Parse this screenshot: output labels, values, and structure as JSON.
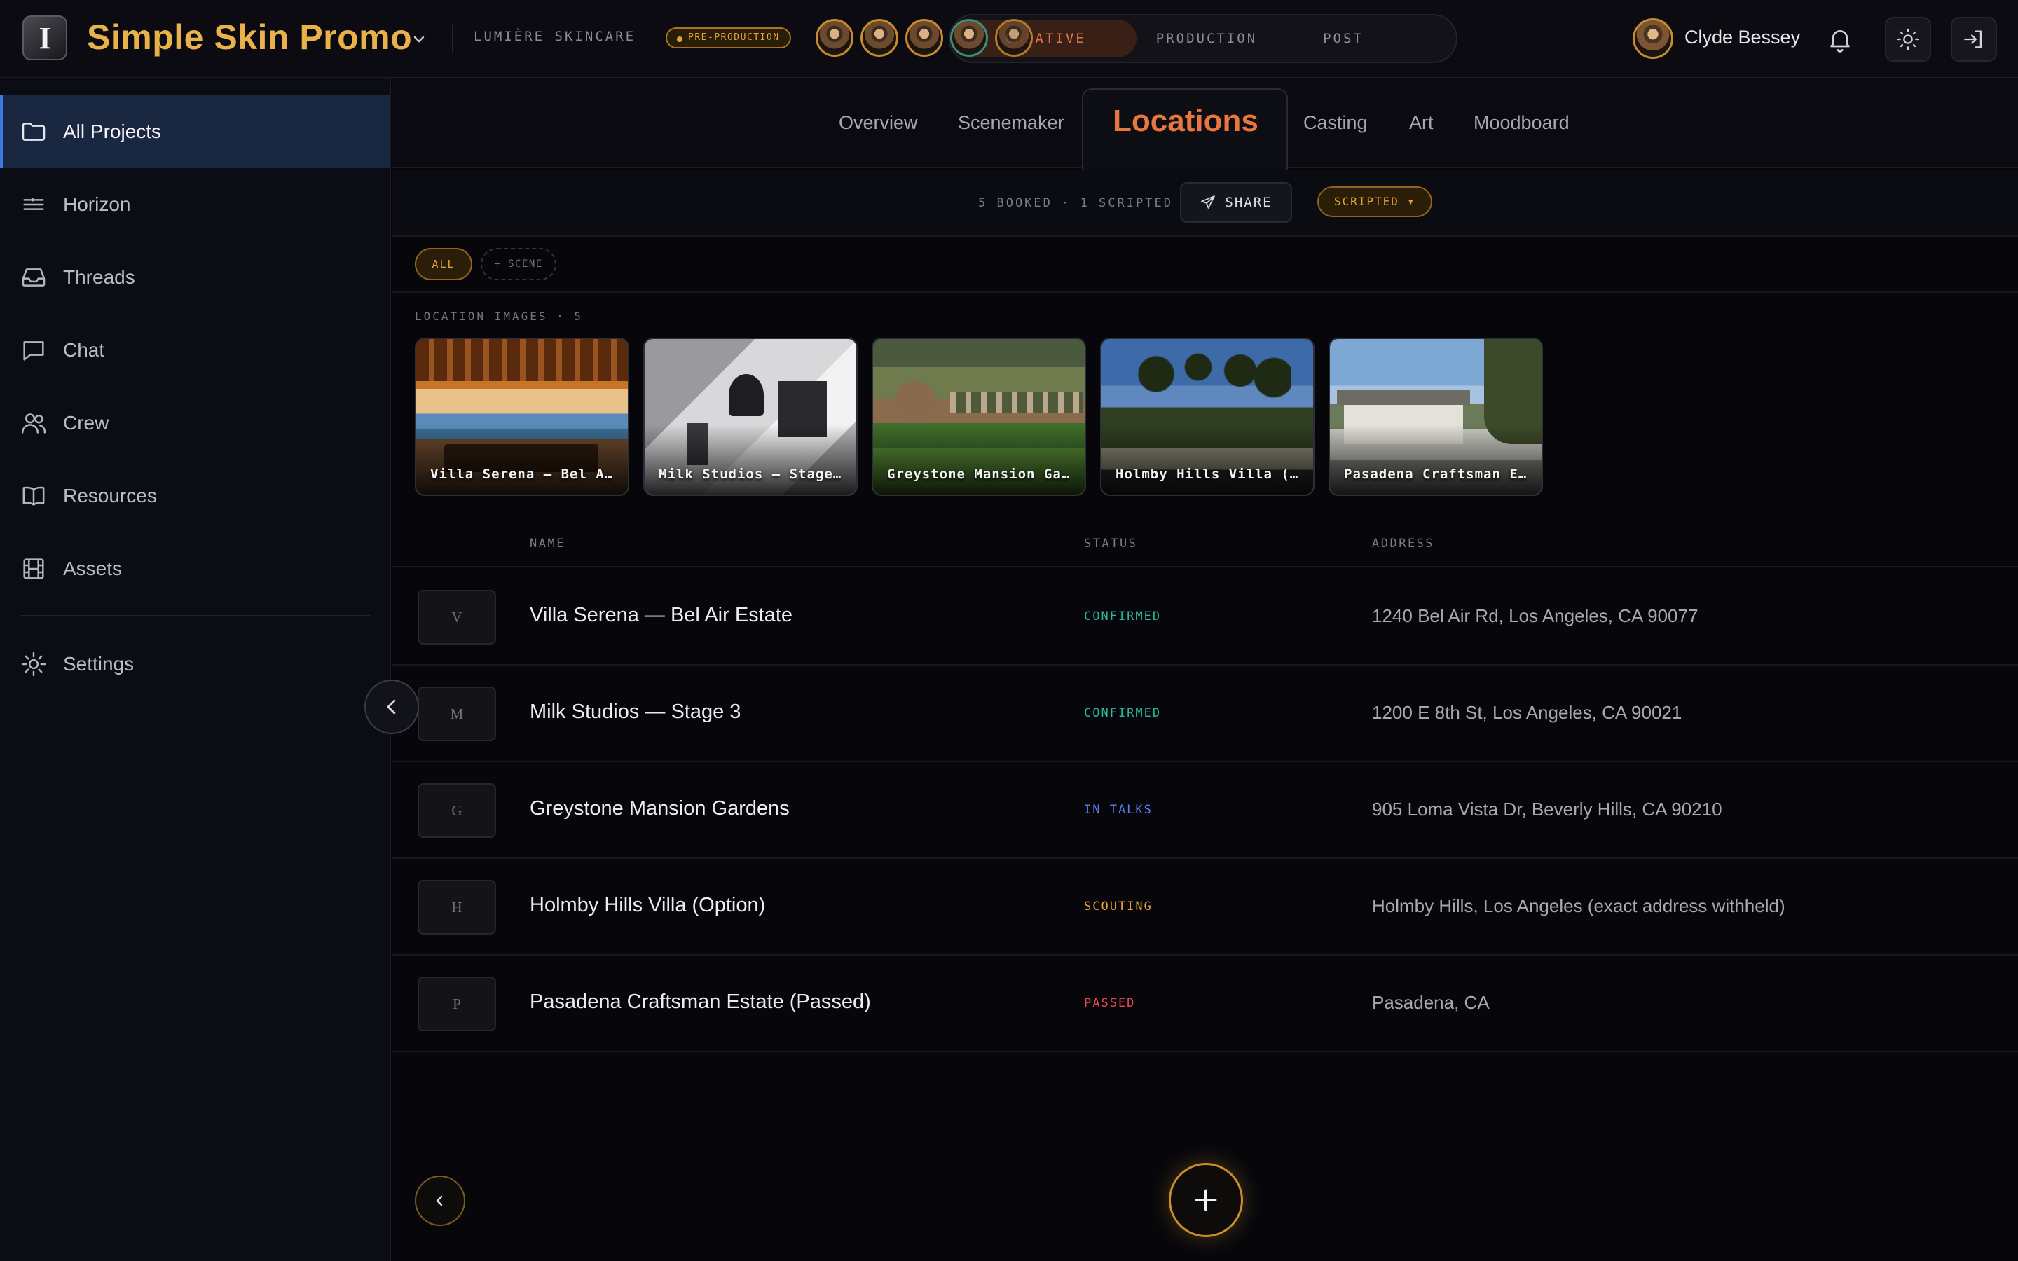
{
  "header": {
    "project_title": "Simple Skin Promo",
    "client": "LUMIÈRE SKINCARE",
    "phase_badge": "PRE-PRODUCTION",
    "phase_tabs": [
      "CREATIVE",
      "PRODUCTION",
      "POST"
    ],
    "active_phase": "CREATIVE",
    "user_name": "Clyde Bessey",
    "logo_letter": "I"
  },
  "sidebar": {
    "items": [
      {
        "label": "All Projects",
        "icon": "folder-icon",
        "active": true
      },
      {
        "label": "Horizon",
        "icon": "horizon-icon"
      },
      {
        "label": "Threads",
        "icon": "inbox-icon"
      },
      {
        "label": "Chat",
        "icon": "chat-icon"
      },
      {
        "label": "Crew",
        "icon": "users-icon"
      },
      {
        "label": "Resources",
        "icon": "book-icon"
      },
      {
        "label": "Assets",
        "icon": "film-icon"
      }
    ],
    "settings_label": "Settings"
  },
  "section_tabs": [
    "Overview",
    "Scenemaker",
    "Locations",
    "Casting",
    "Art",
    "Moodboard"
  ],
  "active_section": "Locations",
  "subbar": {
    "summary": "5 BOOKED · 1 SCRIPTED",
    "share_label": "SHARE",
    "filter_label": "SCRIPTED ▾"
  },
  "filters": {
    "all_label": "ALL",
    "scene_label": "+ SCENE"
  },
  "gallery": {
    "label": "LOCATION IMAGES · 5",
    "captions": [
      "Villa Serena — Bel A…",
      "Milk Studios — Stage…",
      "Greystone Mansion Ga…",
      "Holmby Hills Villa (…",
      "Pasadena Craftsman E…"
    ]
  },
  "table": {
    "columns": [
      "NAME",
      "STATUS",
      "ADDRESS"
    ],
    "rows": [
      {
        "letter": "V",
        "name": "Villa Serena — Bel Air Estate",
        "status": "CONFIRMED",
        "address": "1240 Bel Air Rd, Los Angeles, CA 90077"
      },
      {
        "letter": "M",
        "name": "Milk Studios — Stage 3",
        "status": "CONFIRMED",
        "address": "1200 E 8th St, Los Angeles, CA 90021"
      },
      {
        "letter": "G",
        "name": "Greystone Mansion Gardens",
        "status": "IN TALKS",
        "address": "905 Loma Vista Dr, Beverly Hills, CA 90210"
      },
      {
        "letter": "H",
        "name": "Holmby Hills Villa (Option)",
        "status": "SCOUTING",
        "address": "Holmby Hills, Los Angeles (exact address withheld)"
      },
      {
        "letter": "P",
        "name": "Pasadena Craftsman Estate (Passed)",
        "status": "PASSED",
        "address": "Pasadena, CA"
      }
    ]
  },
  "colors": {
    "accent_gold": "#e8b14a",
    "accent_orange": "#e9753f",
    "status_confirmed": "#2bb59a",
    "status_in_talks": "#5b7cf0",
    "status_scouting": "#e8a335",
    "status_passed": "#e5484d",
    "sidebar_active": "#1a2740"
  }
}
